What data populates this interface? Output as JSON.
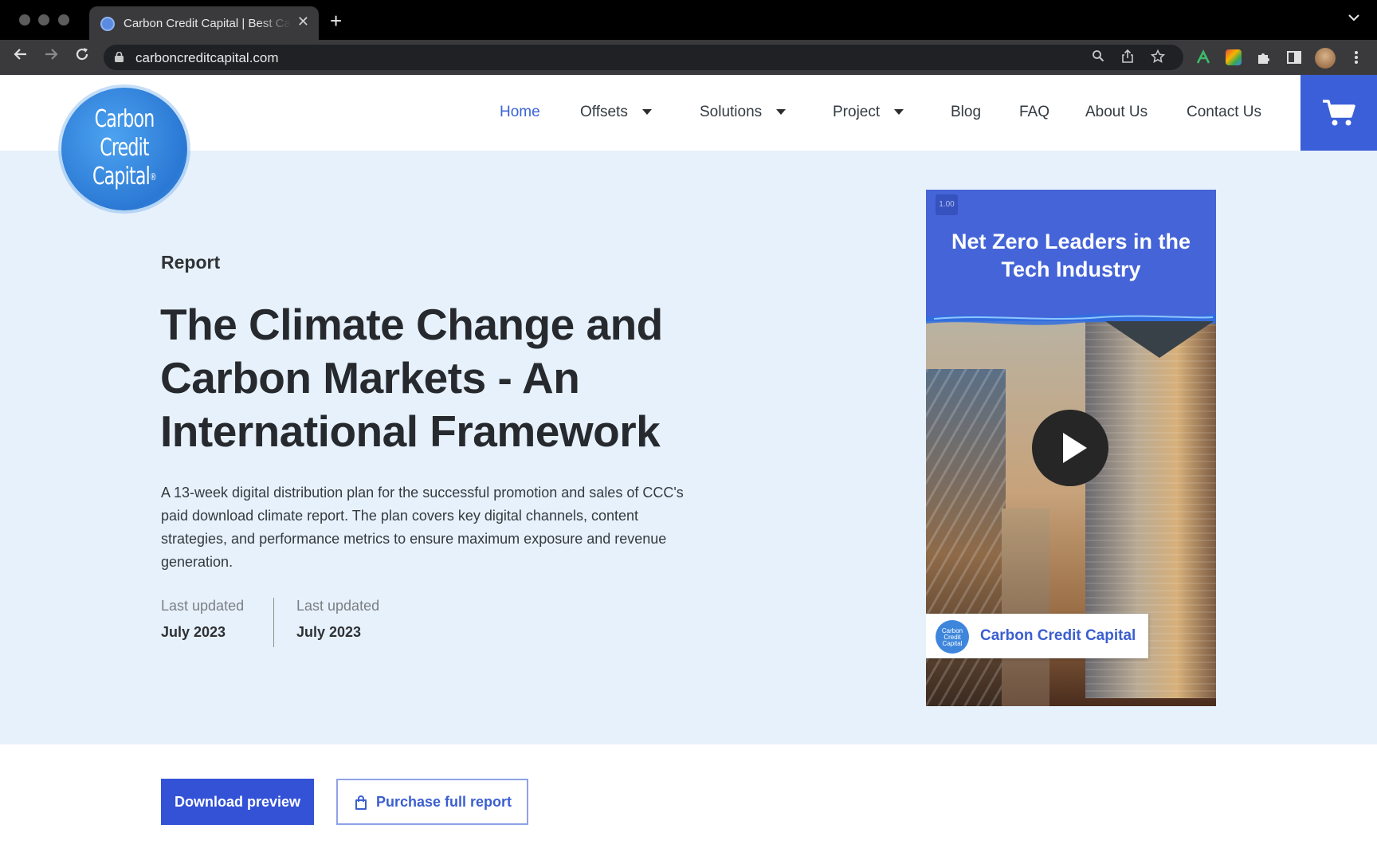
{
  "browser": {
    "tab_title": "Carbon Credit Capital | Best Carbon Offsets",
    "tab_close": "✕",
    "new_tab": "+",
    "url": "carboncreditcapital.com"
  },
  "header": {
    "logo_line1": "Carbon",
    "logo_line2": "Credit",
    "logo_line3": "Capital",
    "logo_reg": "®",
    "nav": {
      "home": "Home",
      "offsets": "Offsets",
      "solutions": "Solutions",
      "project": "Project",
      "blog": "Blog",
      "faq": "FAQ",
      "about": "About Us",
      "contact": "Contact Us"
    },
    "cart_icon": "shopping-cart"
  },
  "hero": {
    "eyebrow": "Report",
    "headline": "The Climate Change and Carbon Markets - An International Framework",
    "description": "A 13-week digital distribution plan for the successful promotion and sales of CCC's paid download climate report. The plan covers key digital channels, content strategies, and performance metrics to ensure maximum exposure and revenue generation.",
    "meta": [
      {
        "label": "Last updated",
        "value": "July 2023"
      },
      {
        "label": "Last updated",
        "value": "July 2023"
      }
    ]
  },
  "video": {
    "speed": "1.00",
    "title": "Net Zero Leaders in the Tech Industry",
    "brand_logo_text": "Carbon Credit Capital",
    "brand_name": "Carbon Credit Capital"
  },
  "actions": {
    "download": "Download preview",
    "purchase": "Purchase full report"
  },
  "colors": {
    "brand_blue": "#3b5fd8",
    "hero_bg": "#e7f1fb",
    "nav_active": "#3a63d6"
  }
}
